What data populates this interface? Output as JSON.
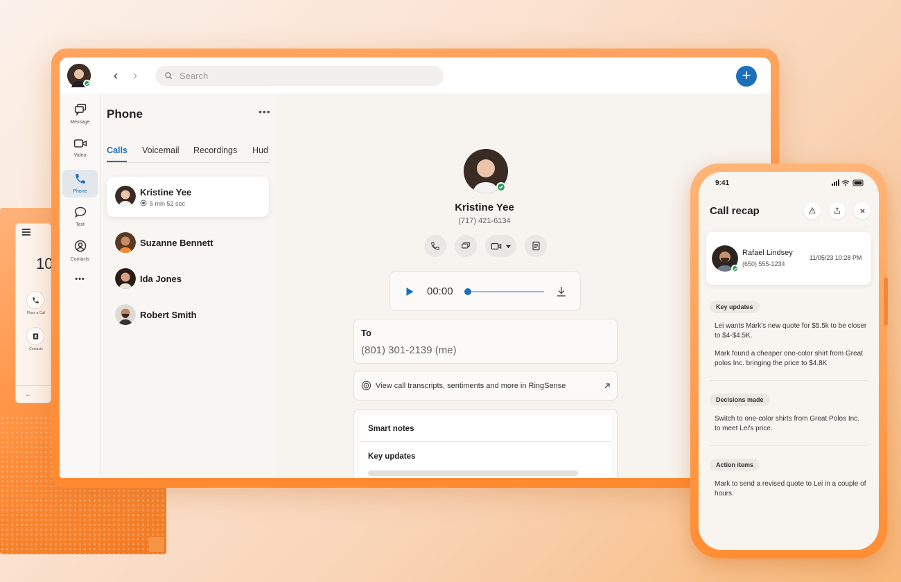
{
  "desk_phone": {
    "time": "10",
    "buttons": [
      {
        "label": "Place a Call",
        "icon": "phone-icon"
      },
      {
        "label": "Contacts",
        "icon": "contacts-icon"
      }
    ],
    "back": "←"
  },
  "topbar": {
    "search_placeholder": "Search",
    "add_label": "+"
  },
  "rail": {
    "items": [
      {
        "label": "Message",
        "icon": "message-icon"
      },
      {
        "label": "Video",
        "icon": "video-icon"
      },
      {
        "label": "Phone",
        "icon": "phone-icon"
      },
      {
        "label": "Text",
        "icon": "text-icon"
      },
      {
        "label": "Contacts",
        "icon": "contacts-icon"
      }
    ],
    "more": "•••"
  },
  "phone_panel": {
    "title": "Phone",
    "more": "•••",
    "tabs": [
      "Calls",
      "Voicemail",
      "Recordings",
      "Hud"
    ],
    "active_call": {
      "name": "Kristine Yee",
      "duration": "5 min 52 sec"
    },
    "contacts": [
      "Suzanne Bennett",
      "Ida Jones",
      "Robert Smith"
    ]
  },
  "detail": {
    "name": "Kristine Yee",
    "number": "(717) 421-6134",
    "player_time": "00:00",
    "progress": 0.02,
    "to_label": "To",
    "to_number": "(801) 301-2139 (me)",
    "ringsense": "View call transcripts, sentiments and more in RingSense",
    "notes_title": "Smart notes",
    "notes_section": "Key updates"
  },
  "phone": {
    "time": "9:41",
    "title": "Call recap",
    "caller": {
      "name": "Rafael Lindsey",
      "number": "(650) 555-1234",
      "datetime": "11/05/23 10:28 PM"
    },
    "sections": [
      {
        "title": "Key updates",
        "paragraphs": [
          "Lei wants Mark's new quote for $5.5k to be closer to $4-$4.5K.",
          "Mark found a cheaper one-color shirt from Great polos Inc. bringing the price to $4.8K"
        ]
      },
      {
        "title": "Decisions made",
        "paragraphs": [
          "Switch to one-color shirts from Great Polos Inc. to meet Lei's price."
        ]
      },
      {
        "title": "Action items",
        "paragraphs": [
          "Mark to send a revised quote to Lei in a couple of hours."
        ]
      }
    ]
  }
}
